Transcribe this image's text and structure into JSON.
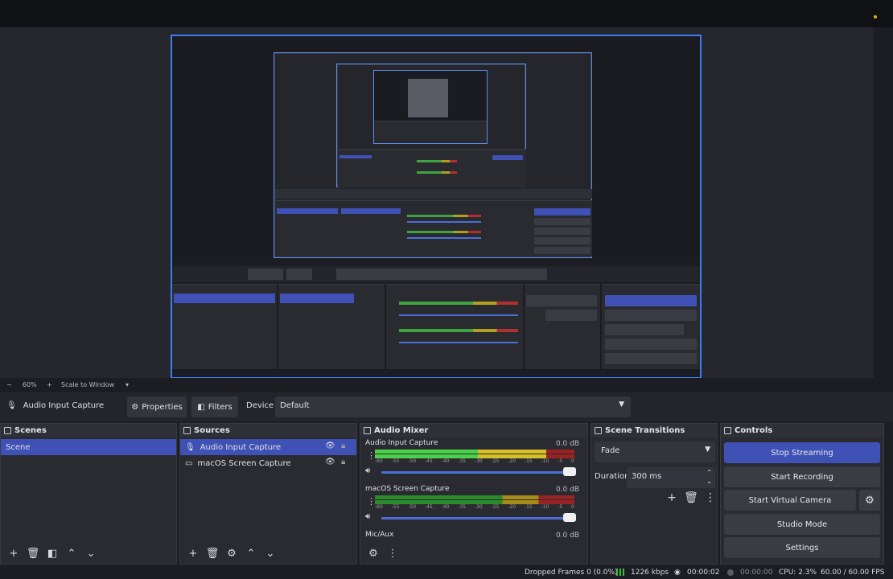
{
  "scale_bar": {
    "minus": "−",
    "zoom": "60%",
    "plus": "+",
    "mode": "Scale to Window",
    "caret": "▾"
  },
  "property_bar": {
    "source_name": "Audio Input Capture",
    "properties_label": "Properties",
    "filters_label": "Filters",
    "device_label": "Device",
    "device_value": "Default"
  },
  "scenes": {
    "title": "Scenes",
    "items": [
      "Scene"
    ]
  },
  "sources": {
    "title": "Sources",
    "items": [
      "Audio Input Capture",
      "macOS Screen Capture"
    ]
  },
  "audio_mixer": {
    "title": "Audio Mixer",
    "channels": [
      {
        "name": "Audio Input Capture",
        "db": "0.0 dB",
        "level": 0.86,
        "volume": 1.0
      },
      {
        "name": "macOS Screen Capture",
        "db": "0.0 dB",
        "level": 0.0,
        "volume": 1.0
      },
      {
        "name": "Mic/Aux",
        "db": "0.0 dB"
      }
    ],
    "ticks": [
      "-60",
      "-55",
      "-50",
      "-45",
      "-40",
      "-35",
      "-30",
      "-25",
      "-20",
      "-15",
      "-10",
      "-5",
      "0"
    ]
  },
  "scene_transitions": {
    "title": "Scene Transitions",
    "transition": "Fade",
    "duration_label": "Duration",
    "duration_value": "300 ms"
  },
  "controls": {
    "title": "Controls",
    "stop_streaming": "Stop Streaming",
    "start_recording": "Start Recording",
    "start_virtual_camera": "Start Virtual Camera",
    "studio_mode": "Studio Mode",
    "settings": "Settings"
  },
  "status_bar": {
    "dropped_frames": "Dropped Frames 0 (0.0%)",
    "bitrate": "1226 kbps",
    "stream_time": "00:00:02",
    "record_time": "00:00:00",
    "cpu": "CPU: 2.3%",
    "fps": "60.00 / 60.00 FPS"
  },
  "colors": {
    "accent": "#3f51b5",
    "preview_border": "#3d7cf0",
    "meter_green": "#4ad04a",
    "meter_yellow": "#d6c028",
    "meter_red": "#9a2222"
  }
}
